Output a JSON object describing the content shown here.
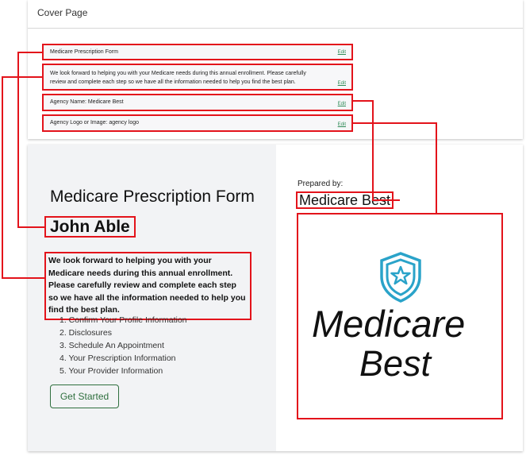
{
  "cover_page": {
    "title": "Cover Page",
    "fields": [
      {
        "label": "Medicare Prescription Form",
        "edit": "Edit"
      },
      {
        "label": "We look forward to helping you with your Medicare needs during this annual enrollment. Please carefully review and complete each step so we have all the information needed to help you find the best plan.",
        "edit": "Edit"
      },
      {
        "label": "Agency Name: Medicare Best",
        "edit": "Edit"
      },
      {
        "label": "Agency Logo or Image: agency logo",
        "edit": "Edit"
      }
    ]
  },
  "preview": {
    "title": "Medicare Prescription Form",
    "name": "John Able",
    "description": "We look forward to helping you with your Medicare needs during this annual enrollment. Please carefully review and complete each step so we have all the information needed to help you find the best plan.",
    "steps": [
      "1. Confirm Your Profile Information",
      "2. Disclosures",
      "3. Schedule An Appointment",
      "4. Your Prescription Information",
      "5. Your Provider Information"
    ],
    "button": "Get Started",
    "prepared_by": "Prepared by:",
    "agency_name": "Medicare Best",
    "logo": {
      "line1": "Medicare",
      "line2": "Best",
      "icon": "shield-star-icon"
    }
  },
  "colors": {
    "annotation": "#e3131b",
    "accent_green": "#2f6f3e",
    "logo_blue": "#2aa3c9"
  }
}
